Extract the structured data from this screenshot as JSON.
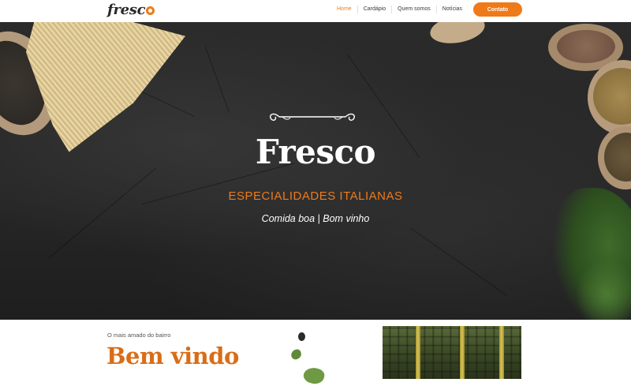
{
  "header": {
    "logo_text": "fresc",
    "nav": [
      {
        "label": "Home",
        "active": true
      },
      {
        "label": "Cardápio",
        "active": false
      },
      {
        "label": "Quem somos",
        "active": false
      },
      {
        "label": "Notícias",
        "active": false
      }
    ],
    "contact_label": "Contato"
  },
  "hero": {
    "title": "Fresco",
    "subtitle": "ESPECIALIDADES ITALIANAS",
    "tagline": "Comida boa | Bom vinho"
  },
  "welcome": {
    "kicker": "O mais amado do bairro",
    "title": "Bem vindo"
  },
  "colors": {
    "accent": "#ef7a1a",
    "hero_bg": "#2a2a2a",
    "welcome_title": "#d96d17"
  },
  "icons": {
    "logo_mark": "orange-slice-icon",
    "ornament": "flourish-divider-icon"
  }
}
